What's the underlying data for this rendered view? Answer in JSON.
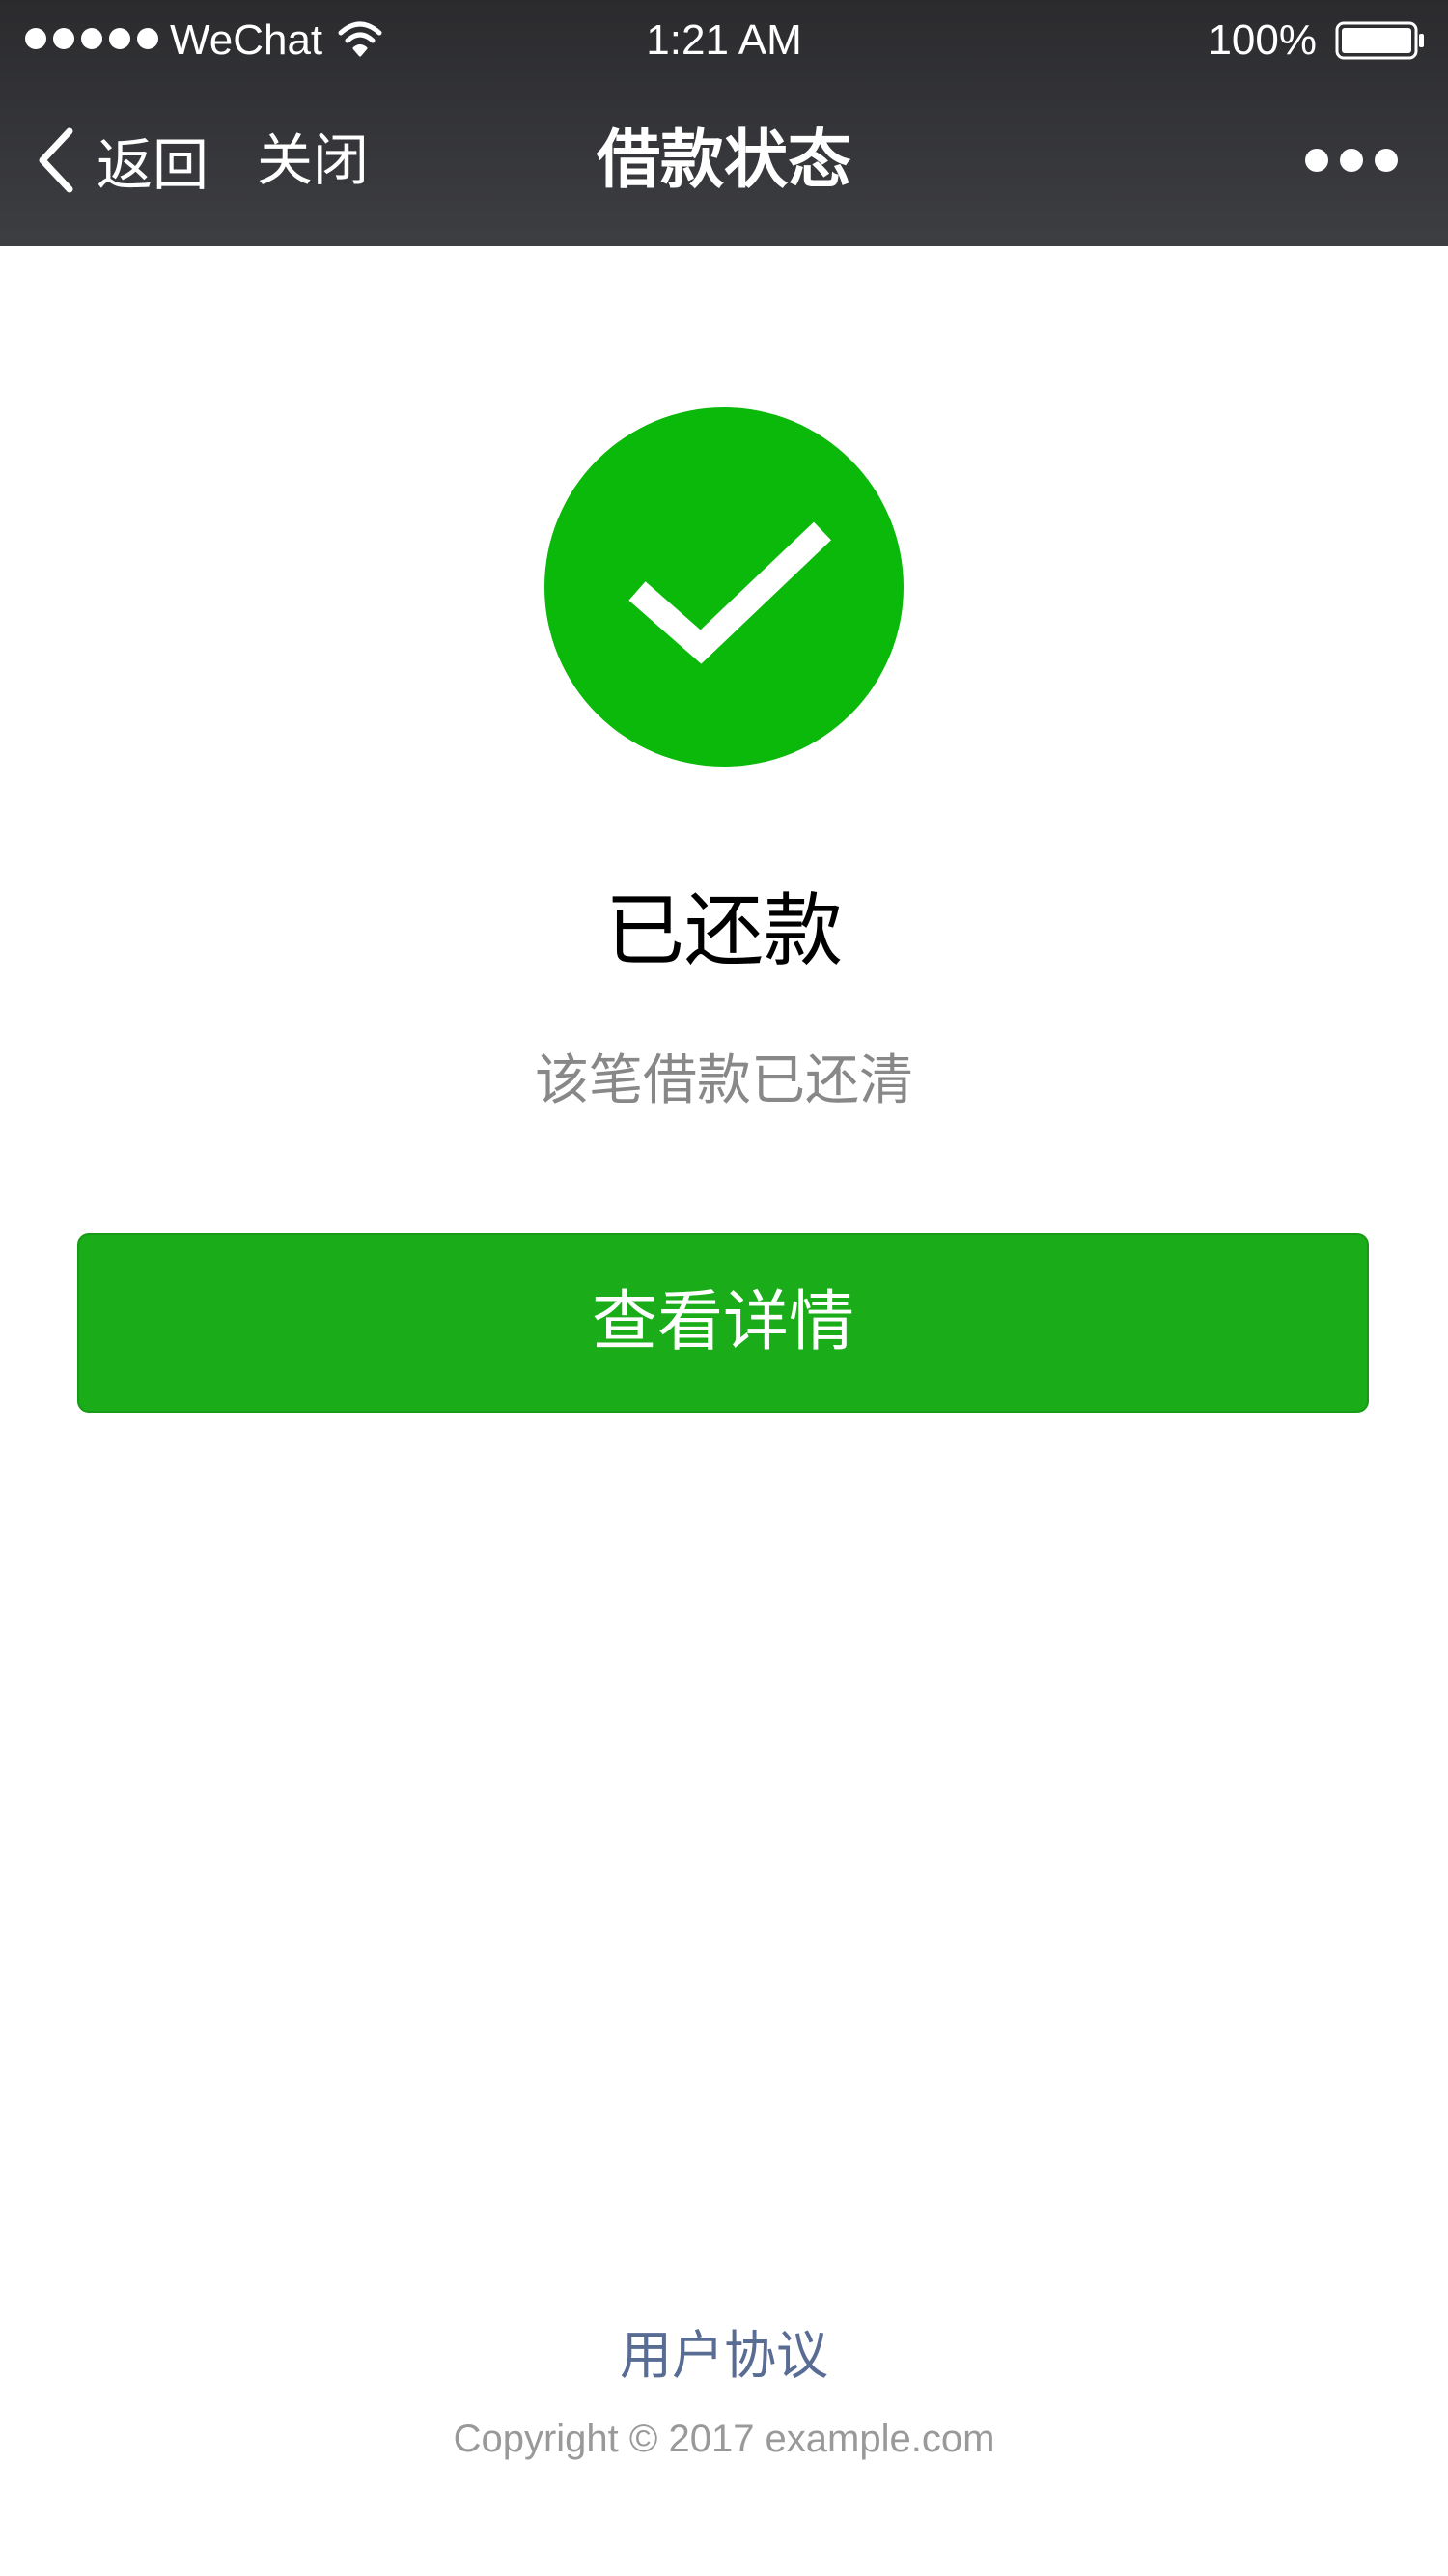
{
  "status_bar": {
    "carrier": "WeChat",
    "time": "1:21 AM",
    "battery": "100%"
  },
  "nav_bar": {
    "back_label": "返回",
    "close_label": "关闭",
    "title": "借款状态"
  },
  "status": {
    "title": "已还款",
    "description": "该笔借款已还清"
  },
  "actions": {
    "detail_label": "查看详情"
  },
  "footer": {
    "agreement_label": "用户协议",
    "copyright": "Copyright © 2017 example.com"
  },
  "colors": {
    "success_green": "#0bb90b",
    "button_green": "#1aad19",
    "link_blue": "#586c94",
    "nav_background": "#37383c"
  }
}
